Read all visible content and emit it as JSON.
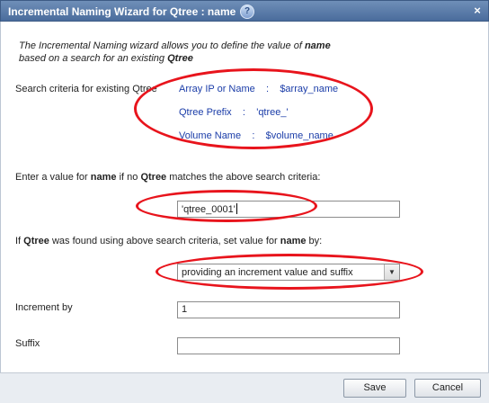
{
  "window": {
    "title": "Incremental Naming Wizard for Qtree : name",
    "help_icon": "?",
    "close_icon": "×"
  },
  "intro": {
    "line1_prefix": "The Incremental Naming wizard allows you to define the value of ",
    "line1_bold": "name",
    "line2_prefix": "based on a search for an existing ",
    "line2_bold": "Qtree"
  },
  "search_criteria": {
    "label": "Search criteria for existing Qtree",
    "items": [
      {
        "name": "Array IP or Name",
        "sep": ":",
        "value": "$array_name"
      },
      {
        "name": "Qtree Prefix",
        "sep": ":",
        "value": "'qtree_'"
      },
      {
        "name": "Volume Name",
        "sep": ":",
        "value": "$volume_name"
      }
    ]
  },
  "no_match": {
    "label_prefix": "Enter a value for ",
    "label_name": "name",
    "label_mid": " if no ",
    "label_qtree": "Qtree",
    "label_suffix": " matches the above search criteria:",
    "value": "'qtree_0001'"
  },
  "found": {
    "label_prefix": "If ",
    "label_qtree": "Qtree",
    "label_mid": " was found using above search criteria, set value for ",
    "label_name": "name",
    "label_suffix": " by:",
    "selected": "providing an increment value and suffix"
  },
  "increment": {
    "label": "Increment by",
    "value": "1"
  },
  "suffix": {
    "label": "Suffix",
    "value": ""
  },
  "buttons": {
    "save": "Save",
    "cancel": "Cancel"
  },
  "colors": {
    "annotation": "#e8141c",
    "criteria_text": "#1a3ca8",
    "titlebar": "#4a6c9c"
  }
}
